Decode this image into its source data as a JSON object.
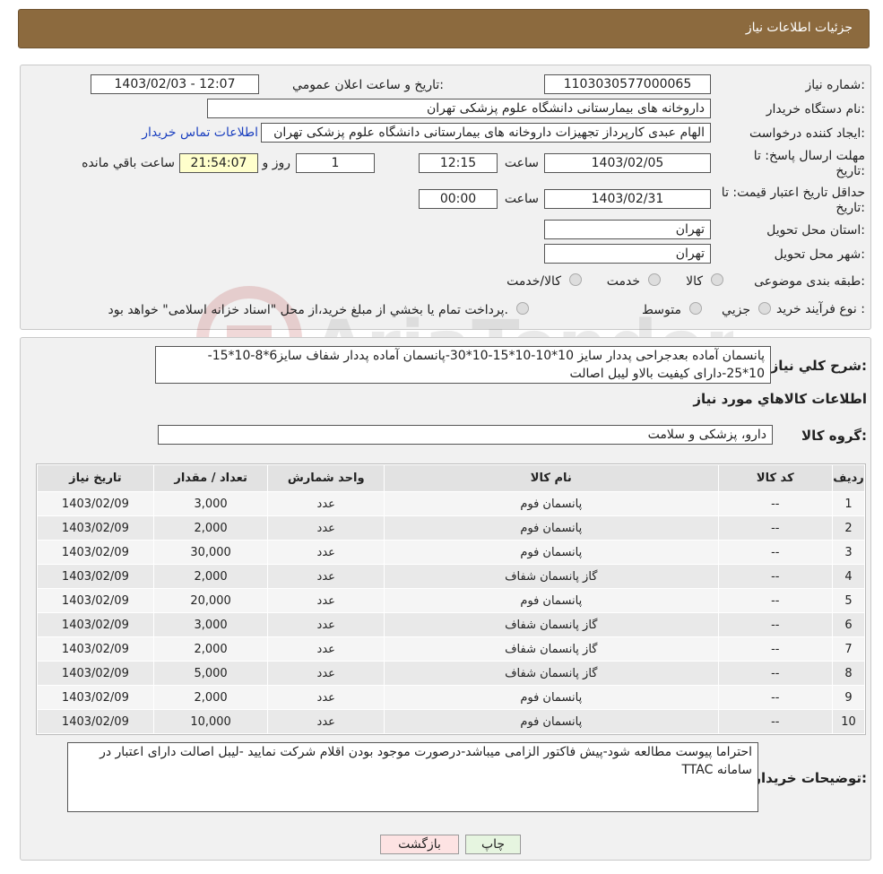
{
  "header": {
    "title": "جزئیات اطلاعات نیاز"
  },
  "form": {
    "need_number_label": "شماره نیاز:",
    "need_number": "1103030577000065",
    "announce_label": "تاریخ و ساعت اعلان عمومي:",
    "announce_value": "1403/02/03 - 12:07",
    "buyer_org_label": "نام دستگاه خريدار:",
    "buyer_org": "داروخانه های بیمارستانی دانشگاه علوم پزشکی تهران",
    "requester_label": "ايجاد کننده درخواست:",
    "requester": "الهام عبدی کارپرداز تجهیزات داروخانه های بیمارستانی دانشگاه علوم پزشکی تهران",
    "contact_link": "اطلاعات تماس خريدار",
    "deadline_label_1": "مهلت ارسال پاسخ: تا",
    "deadline_label_2": "تاریخ:",
    "deadline_date": "1403/02/05",
    "time_label": "ساعت",
    "deadline_time": "12:15",
    "days_value": "1",
    "days_label": "روز و",
    "remaining_time": "21:54:07",
    "remaining_label": "ساعت باقي مانده",
    "validity_label_1": "حداقل تاريخ اعتبار قيمت: تا",
    "validity_label_2": "تاريخ:",
    "validity_date": "1403/02/31",
    "validity_time_label": "ساعت",
    "validity_time": "00:00",
    "province_label": "استان محل تحويل:",
    "province": "تهران",
    "city_label": "شهر محل تحويل:",
    "city": "تهران",
    "category_label": "طبقه بندی موضوعی:",
    "category_options": [
      "کالا",
      "خدمت",
      "کالا/خدمت"
    ],
    "process_label": "نوع فرآيند خريد :",
    "process_options": [
      "جزيي",
      "متوسط"
    ],
    "payment_note": "پرداخت تمام يا بخشي از مبلغ خريد،از محل \"اسناد خزانه اسلامی\" خواهد بود."
  },
  "details": {
    "summary_label": "شرح کلي نياز:",
    "summary_line1": "پانسمان آماده بعدجراحی پددار سایز 10*10-10*15-10*30-پانسمان آماده پددار شفاف سایز6*8-10*15-",
    "summary_line2": "10*25-دارای کیفیت بالاو لیبل اصالت",
    "goods_info_title": "اطلاعات کالاهاي مورد نياز",
    "goods_group_label": "گروه کالا:",
    "goods_group": "دارو، پزشکی و سلامت"
  },
  "table": {
    "headers": [
      "رديف",
      "کد کالا",
      "نام کالا",
      "واحد شمارش",
      "تعداد / مقدار",
      "تاریخ نیاز"
    ],
    "rows": [
      [
        "1",
        "--",
        "پانسمان فوم",
        "عدد",
        "3,000",
        "1403/02/09"
      ],
      [
        "2",
        "--",
        "پانسمان فوم",
        "عدد",
        "2,000",
        "1403/02/09"
      ],
      [
        "3",
        "--",
        "پانسمان فوم",
        "عدد",
        "30,000",
        "1403/02/09"
      ],
      [
        "4",
        "--",
        "گاز پانسمان شفاف",
        "عدد",
        "2,000",
        "1403/02/09"
      ],
      [
        "5",
        "--",
        "پانسمان فوم",
        "عدد",
        "20,000",
        "1403/02/09"
      ],
      [
        "6",
        "--",
        "گاز پانسمان شفاف",
        "عدد",
        "3,000",
        "1403/02/09"
      ],
      [
        "7",
        "--",
        "گاز پانسمان شفاف",
        "عدد",
        "2,000",
        "1403/02/09"
      ],
      [
        "8",
        "--",
        "گاز پانسمان شفاف",
        "عدد",
        "5,000",
        "1403/02/09"
      ],
      [
        "9",
        "--",
        "پانسمان فوم",
        "عدد",
        "2,000",
        "1403/02/09"
      ],
      [
        "10",
        "--",
        "پانسمان فوم",
        "عدد",
        "10,000",
        "1403/02/09"
      ]
    ]
  },
  "buyer_notes": {
    "label": "توضيحات خريدار:",
    "text": "احتراما پیوست مطالعه شود-پیش فاکتور الزامی میباشد-درصورت موجود بودن اقلام شرکت نمایید -لیبل اصالت دارای اعتبار در سامانه TTAC"
  },
  "buttons": {
    "print": "چاپ",
    "back": "بازگشت"
  },
  "colors": {
    "header_bg": "#8c6a3e",
    "back_button_bg": "#fde3e3",
    "print_button_bg": "#e6f5e0"
  }
}
